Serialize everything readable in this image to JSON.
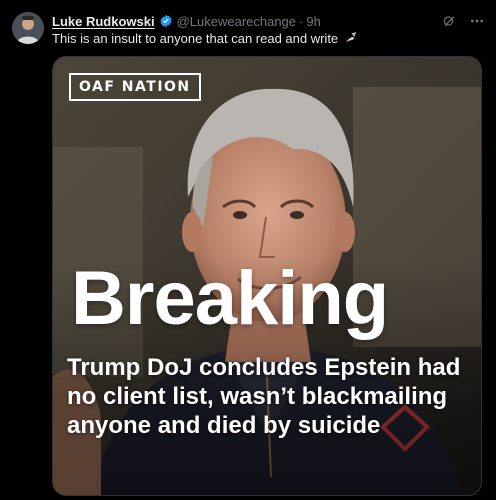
{
  "tweet": {
    "display_name": "Luke Rudkowski",
    "handle": "@Lukewearechange",
    "separator": "·",
    "timestamp": "9h",
    "text": "This is an insult to anyone that can read and write",
    "text_emoji": "✍",
    "verified": true,
    "icons": {
      "verified": "verified-badge-icon",
      "grok": "grok-icon",
      "more": "more-icon"
    },
    "colors": {
      "background": "#000000",
      "verified": "#1d9bf0",
      "muted": "#71767b",
      "text": "#e7e9ea"
    }
  },
  "media": {
    "watermark": "OAF NATION",
    "breaking": "Breaking",
    "headline": "Trump DoJ concludes Epstein had no client list, wasn’t blackmailing anyone and died by suicide"
  }
}
